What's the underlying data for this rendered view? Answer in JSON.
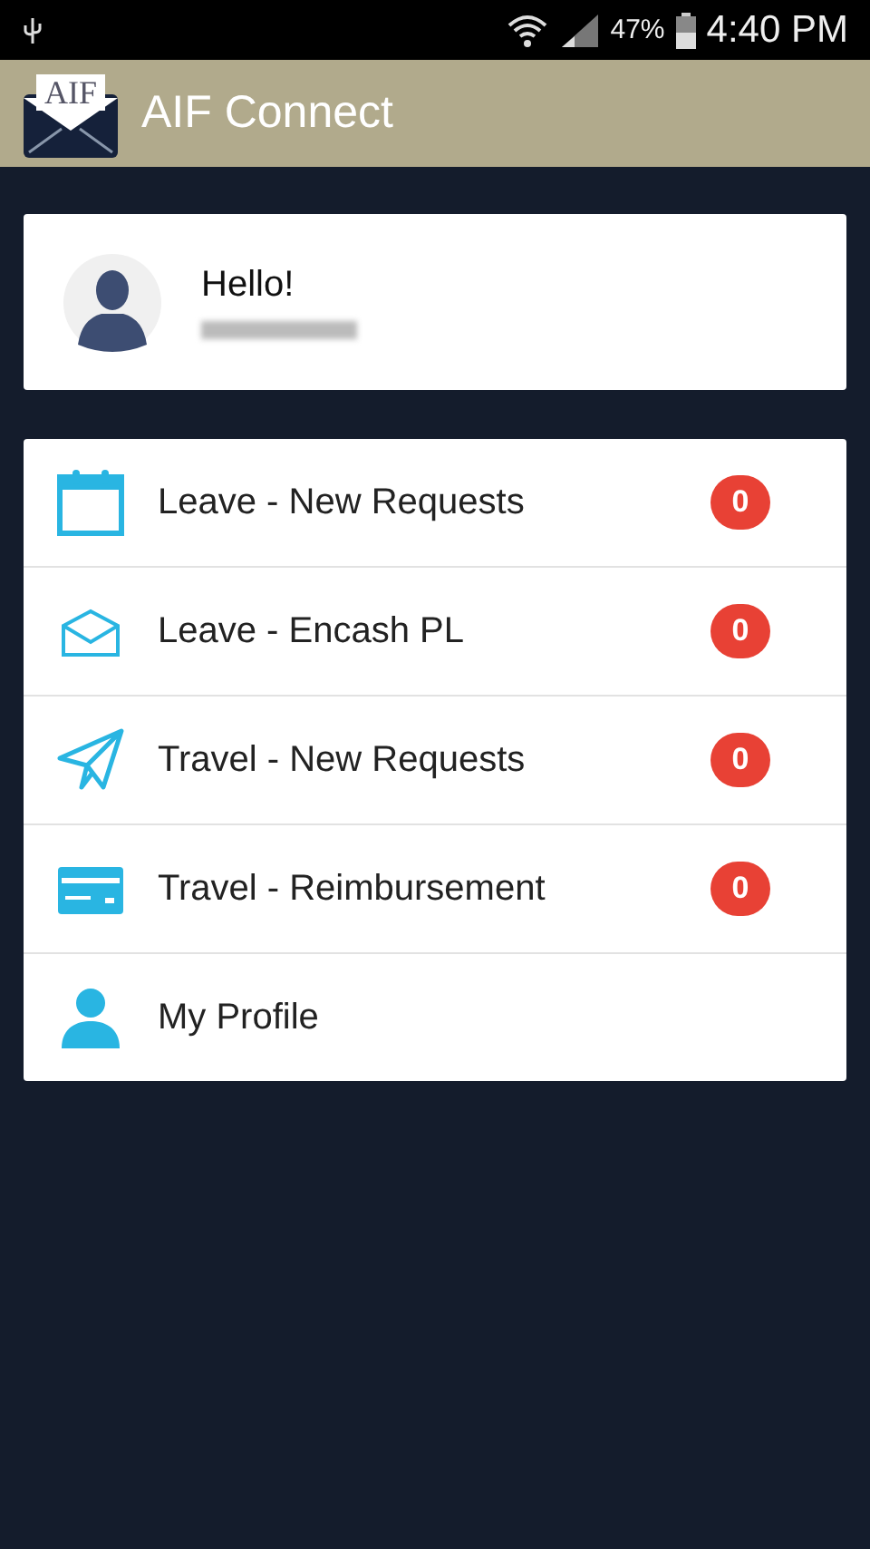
{
  "status_bar": {
    "battery": "47%",
    "time": "4:40 PM"
  },
  "app_bar": {
    "logo_text": "AIF",
    "title": "AIF Connect"
  },
  "profile_card": {
    "greeting": "Hello!"
  },
  "menu": [
    {
      "label": "Leave - New Requests",
      "badge": "0"
    },
    {
      "label": "Leave - Encash PL",
      "badge": "0"
    },
    {
      "label": "Travel - New Requests",
      "badge": "0"
    },
    {
      "label": "Travel - Reimbursement",
      "badge": "0"
    },
    {
      "label": "My Profile"
    }
  ]
}
